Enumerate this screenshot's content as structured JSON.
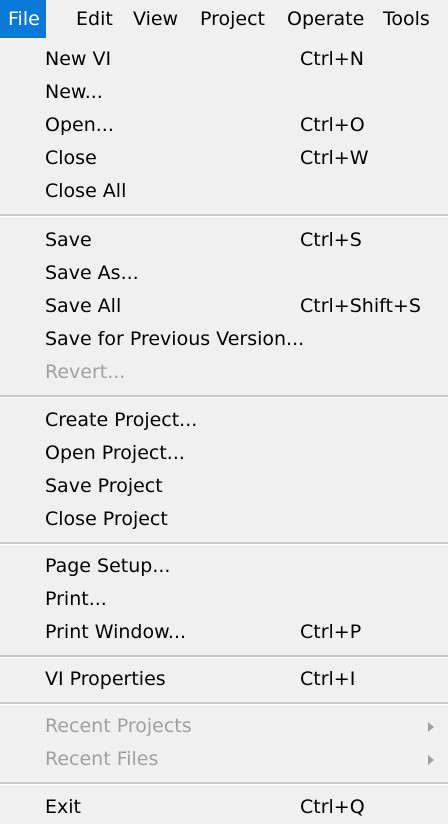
{
  "menubar": {
    "items": [
      {
        "label": "File",
        "active": true
      },
      {
        "label": "Edit"
      },
      {
        "label": "View"
      },
      {
        "label": "Project"
      },
      {
        "label": "Operate"
      },
      {
        "label": "Tools"
      }
    ]
  },
  "file_menu": {
    "groups": [
      [
        {
          "label": "New VI",
          "shortcut": "Ctrl+N"
        },
        {
          "label": "New..."
        },
        {
          "label": "Open...",
          "shortcut": "Ctrl+O"
        },
        {
          "label": "Close",
          "shortcut": "Ctrl+W"
        },
        {
          "label": "Close All"
        }
      ],
      [
        {
          "label": "Save",
          "shortcut": "Ctrl+S"
        },
        {
          "label": "Save As..."
        },
        {
          "label": "Save All",
          "shortcut": "Ctrl+Shift+S"
        },
        {
          "label": "Save for Previous Version..."
        },
        {
          "label": "Revert...",
          "disabled": true
        }
      ],
      [
        {
          "label": "Create Project..."
        },
        {
          "label": "Open Project..."
        },
        {
          "label": "Save Project"
        },
        {
          "label": "Close Project"
        }
      ],
      [
        {
          "label": "Page Setup..."
        },
        {
          "label": "Print..."
        },
        {
          "label": "Print Window...",
          "shortcut": "Ctrl+P"
        }
      ],
      [
        {
          "label": "VI Properties",
          "shortcut": "Ctrl+I"
        }
      ],
      [
        {
          "label": "Recent Projects",
          "disabled": true,
          "submenu": true
        },
        {
          "label": "Recent Files",
          "disabled": true,
          "submenu": true
        }
      ],
      [
        {
          "label": "Exit",
          "shortcut": "Ctrl+Q"
        }
      ]
    ]
  }
}
